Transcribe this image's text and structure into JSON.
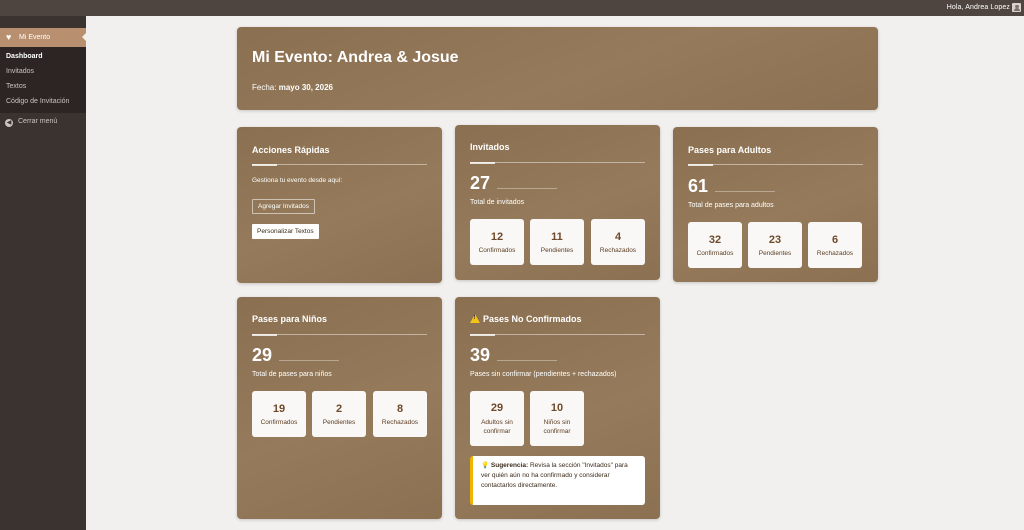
{
  "topbar": {
    "greeting": "Hola, Andrea Lopez"
  },
  "sidebar": {
    "app_title": "Mi Evento",
    "items": [
      {
        "label": "Dashboard",
        "current": true
      },
      {
        "label": "Invitados"
      },
      {
        "label": "Textos"
      },
      {
        "label": "Código de Invitación"
      }
    ],
    "collapse_label": "Cerrar menú"
  },
  "hero": {
    "title": "Mi Evento: Andrea & Josue",
    "date_label": "Fecha:",
    "date_value": "mayo 30, 2026"
  },
  "quick_actions": {
    "title": "Acciones Rápidas",
    "description": "Gestiona tu evento desde aquí:",
    "buttons": {
      "add_guests": "Agregar Invitados",
      "customize_texts": "Personalizar Textos"
    }
  },
  "guests": {
    "title": "Invitados",
    "total": "27",
    "caption": "Total de invitados",
    "stats": [
      {
        "value": "12",
        "label": "Confirmados"
      },
      {
        "value": "11",
        "label": "Pendientes"
      },
      {
        "value": "4",
        "label": "Rechazados"
      }
    ]
  },
  "adult_passes": {
    "title": "Pases para Adultos",
    "total": "61",
    "caption": "Total de pases para adultos",
    "stats": [
      {
        "value": "32",
        "label": "Confirmados"
      },
      {
        "value": "23",
        "label": "Pendientes"
      },
      {
        "value": "6",
        "label": "Rechazados"
      }
    ]
  },
  "kid_passes": {
    "title": "Pases para Niños",
    "total": "29",
    "caption": "Total de pases para niños",
    "stats": [
      {
        "value": "19",
        "label": "Confirmados"
      },
      {
        "value": "2",
        "label": "Pendientes"
      },
      {
        "value": "8",
        "label": "Rechazados"
      }
    ]
  },
  "unconfirmed": {
    "title": "Pases No Confirmados",
    "total": "39",
    "caption": "Pases sin confirmar (pendientes + rechazados)",
    "stats": [
      {
        "value": "29",
        "label_line1": "Adultos sin",
        "label_line2": "confirmar"
      },
      {
        "value": "10",
        "label_line1": "Niños sin",
        "label_line2": "confirmar"
      }
    ],
    "tip": {
      "label": "Sugerencia:",
      "text": "Revisa la sección \"Invitados\" para ver quién aún no ha confirmado y considerar contactarlos directamente."
    }
  },
  "colors": {
    "card": "#8f7555",
    "sidebar": "#3b3330",
    "active": "#b8906f",
    "accent": "#f0b400"
  }
}
